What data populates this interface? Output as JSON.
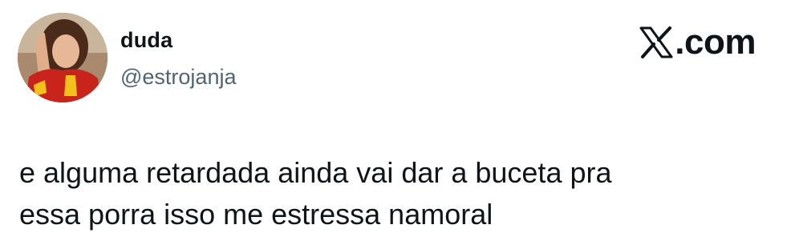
{
  "tweet": {
    "author": {
      "display_name": "duda",
      "handle": "@estrojanja",
      "avatar_icon": "profile-photo"
    },
    "brand": {
      "icon": "x-logo-icon",
      "text": ".com"
    },
    "text_lines": [
      "e alguma retardada ainda vai dar a buceta pra",
      "essa porra isso me estressa namoral"
    ]
  },
  "colors": {
    "text_primary": "#0f1419",
    "text_secondary": "#536471",
    "background": "#ffffff"
  }
}
